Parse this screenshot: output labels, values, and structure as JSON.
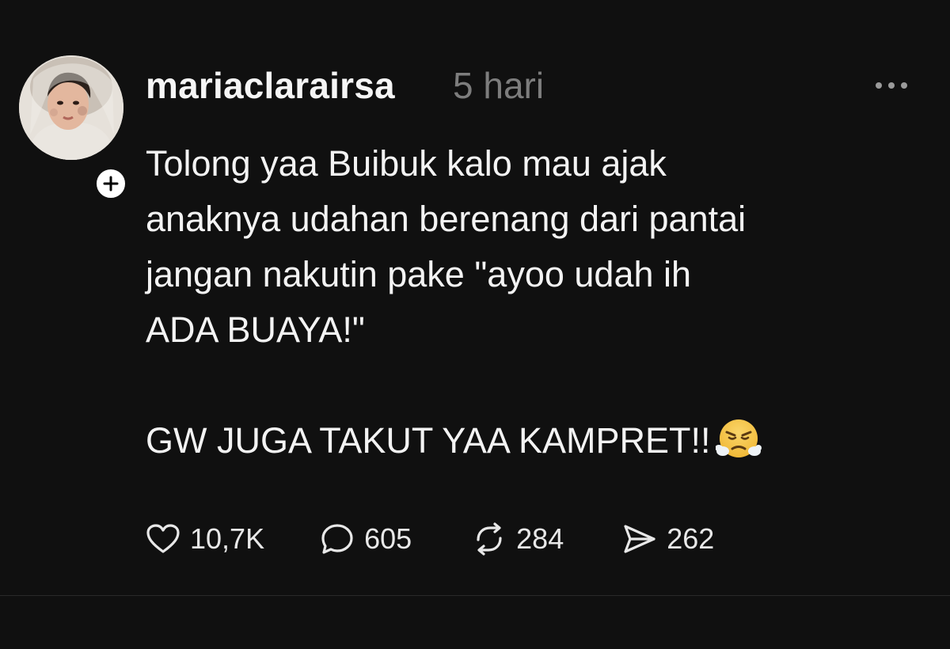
{
  "post": {
    "author": {
      "username": "mariaclarairsa",
      "avatar_icon": "profile-photo",
      "follow_icon": "plus-icon"
    },
    "timestamp": "5 hari",
    "more_icon": "ellipsis-icon",
    "body": {
      "lines": [
        "Tolong yaa Buibuk kalo mau ajak",
        "anaknya udahan berenang dari pantai",
        "jangan nakutin pake \"ayoo udah ih",
        "ADA BUAYA!\""
      ],
      "closing": "GW JUGA TAKUT YAA KAMPRET!!",
      "emoji": "face-with-steam-from-nose"
    },
    "actions": {
      "like": {
        "icon": "heart-icon",
        "count": "10,7K"
      },
      "comment": {
        "icon": "comment-bubble-icon",
        "count": "605"
      },
      "repost": {
        "icon": "repost-icon",
        "count": "284"
      },
      "share": {
        "icon": "send-icon",
        "count": "262"
      }
    }
  },
  "colors": {
    "background": "#101010",
    "text_primary": "#f3f3f3",
    "text_secondary": "#7d7d7d",
    "divider": "#2a2a2a"
  }
}
